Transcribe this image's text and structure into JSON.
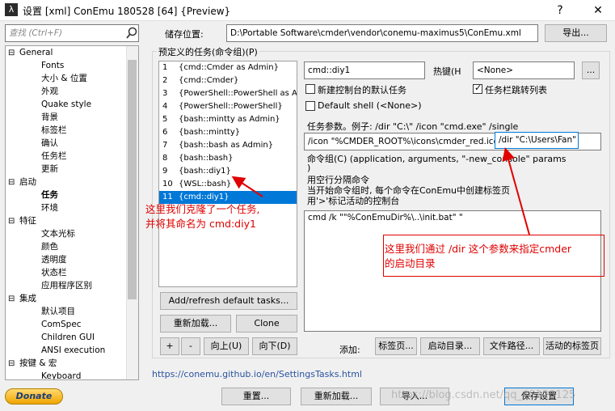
{
  "window": {
    "title": "设置 [xml] ConEmu 180528 [64] {Preview}",
    "icon": "λ",
    "help": "?",
    "close": "✕"
  },
  "search": {
    "placeholder": "查找 (Ctrl+F)"
  },
  "storage": {
    "label": "储存位置:",
    "path": "D:\\Portable Software\\cmder\\vendor\\conemu-maximus5\\ConEmu.xml",
    "export_label": "导出..."
  },
  "tree": {
    "items": [
      {
        "label": "General",
        "expander": "⊟"
      },
      {
        "label": "Fonts"
      },
      {
        "label": "大小 & 位置"
      },
      {
        "label": "外观"
      },
      {
        "label": "Quake style"
      },
      {
        "label": "背景"
      },
      {
        "label": "标签栏"
      },
      {
        "label": "确认"
      },
      {
        "label": "任务栏"
      },
      {
        "label": "更新"
      },
      {
        "label": "启动",
        "expander": "⊟"
      },
      {
        "label": "任务"
      },
      {
        "label": "环境"
      },
      {
        "label": "特征",
        "expander": "⊟"
      },
      {
        "label": "文本光标"
      },
      {
        "label": "颜色"
      },
      {
        "label": "透明度"
      },
      {
        "label": "状态栏"
      },
      {
        "label": "应用程序区别"
      },
      {
        "label": "集成",
        "expander": "⊟"
      },
      {
        "label": "默认项目"
      },
      {
        "label": "ComSpec"
      },
      {
        "label": "Children GUI"
      },
      {
        "label": "ANSI execution"
      },
      {
        "label": "按键 & 宏",
        "expander": "⊟"
      },
      {
        "label": "Keyboard"
      }
    ]
  },
  "tasks": {
    "group_label": "预定义的任务(命令组)(P)",
    "items": [
      {
        "num": "1",
        "name": "{cmd::Cmder as Admin}"
      },
      {
        "num": "2",
        "name": "{cmd::Cmder}"
      },
      {
        "num": "3",
        "name": "{PowerShell::PowerShell as Ac"
      },
      {
        "num": "4",
        "name": "{PowerShell::PowerShell}"
      },
      {
        "num": "5",
        "name": "{bash::mintty as Admin}"
      },
      {
        "num": "6",
        "name": "{bash::mintty}"
      },
      {
        "num": "7",
        "name": "{bash::bash as Admin}"
      },
      {
        "num": "8",
        "name": "{bash::bash}"
      },
      {
        "num": "9",
        "name": "{bash::diy1}"
      },
      {
        "num": "10",
        "name": "{WSL::bash}"
      },
      {
        "num": "11",
        "name": "{cmd::diy1}"
      }
    ],
    "add_refresh": "Add/refresh default tasks...",
    "reload": "重新加载...",
    "clone": "Clone",
    "plus": "+",
    "minus": "-",
    "up": "向上(U)",
    "down": "向下(D)"
  },
  "task_detail": {
    "name_value": "cmd::diy1",
    "hotkey_label": "热键(H",
    "hotkey_value": "<None>",
    "more": "...",
    "new_console_default": "新建控制台的默认任务",
    "taskbar_jump": "任务栏跳转列表",
    "default_shell": "Default shell (<None>)",
    "params_label": "任务参数。例子: /dir \"C:\\\" /icon \"cmd.exe\" /single",
    "params_value_a": "/icon \"%CMDER_ROOT%\\icons\\cmder_red.ico\"",
    "params_value_b": "/dir \"C:\\Users\\Fan\"",
    "cmd_label_1": "命令组(C)  (application, arguments, \"-new_console\" params",
    "cmd_label_2": ")",
    "cmd_label_3": "用空行分隔命令",
    "cmd_label_4": "当开始命令组时, 每个命令在ConEmu中创建标签页",
    "cmd_label_5": "用'>'标记活动的控制台",
    "commands": "cmd /k \"\"%ConEmuDir%\\..\\init.bat\" \"",
    "add_label": "添加:",
    "tabs_btn": "标签页...",
    "startdir_btn": "启动目录...",
    "filepath_btn": "文件路径...",
    "activetab_btn": "活动的标签页"
  },
  "annotations": {
    "left_1": "这里我们克隆了一个任务,",
    "left_2": "并将其命名为 cmd:diy1",
    "right_1": "这里我们通过 /dir 这个参数来指定cmder",
    "right_2": "的启动目录"
  },
  "footer": {
    "link": "https://conemu.github.io/en/SettingsTasks.html",
    "donate": "Donate",
    "reset": "重置...",
    "reload": "重新加载...",
    "import": "导入...",
    "save": "保存设置",
    "watermark": "https://blog.csdn.net/qq_40123125"
  },
  "colors": {
    "selection": "#0078d7",
    "annotation": "#e00000",
    "link": "#2a53a0"
  }
}
